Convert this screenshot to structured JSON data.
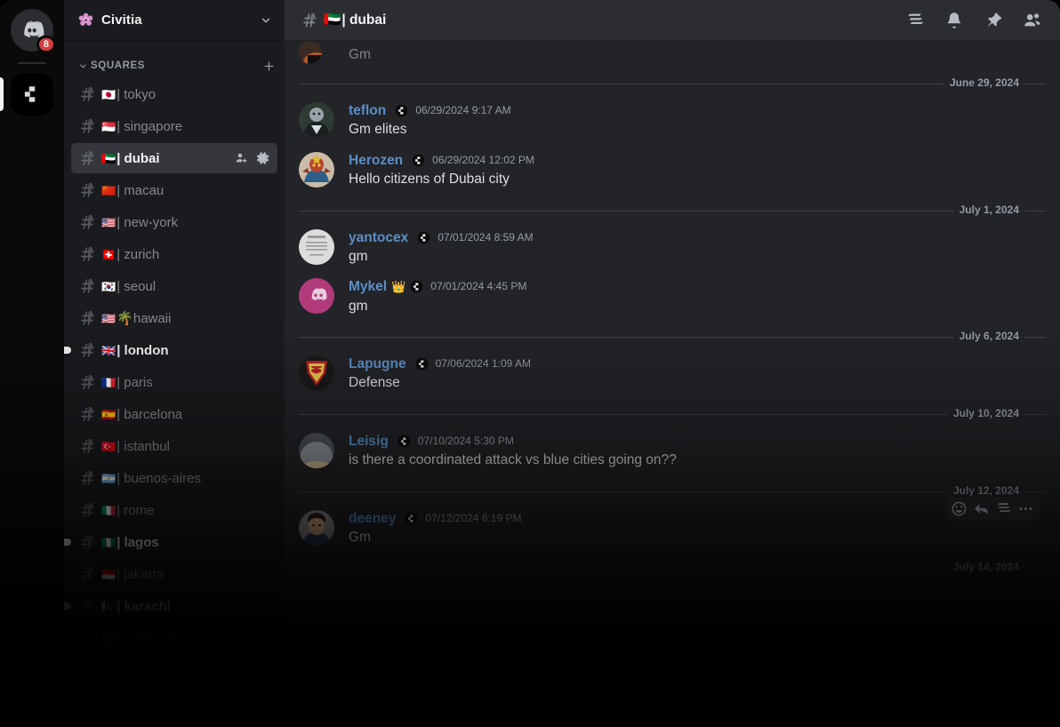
{
  "colors": {
    "accent_username": "#5b8fc7",
    "badge_red": "#d83c3e",
    "sidebar_bg": "#1a1b1e",
    "chat_bg": "#232428",
    "header_bg": "#2b2d31",
    "selected_channel_bg": "#35373c",
    "text_primary": "#f2f3f5",
    "text_muted": "#949ba4"
  },
  "rail": {
    "home_icon": "discord-home-icon",
    "home_badge_count": "8",
    "active_server_icon": "civitia-server-icon"
  },
  "sidebar": {
    "server_name": "Civitia",
    "server_emoji": "pink-flower-icon",
    "dropdown_icon": "chevron-down-icon",
    "category": {
      "label": "SQUARES",
      "collapse_icon": "chevron-down-icon",
      "add_icon": "plus-icon"
    },
    "channels": [
      {
        "flag": "🇯🇵",
        "name": "| tokyo",
        "selected": false,
        "unread": false
      },
      {
        "flag": "🇸🇬",
        "name": "| singapore",
        "selected": false,
        "unread": false
      },
      {
        "flag": "🇦🇪",
        "name": "| dubai",
        "selected": true,
        "unread": false
      },
      {
        "flag": "🇨🇳",
        "name": "| macau",
        "selected": false,
        "unread": false
      },
      {
        "flag": "🇺🇸",
        "name": "| new-york",
        "selected": false,
        "unread": false
      },
      {
        "flag": "🇨🇭",
        "name": "| zurich",
        "selected": false,
        "unread": false
      },
      {
        "flag": "🇰🇷",
        "name": "| seoul",
        "selected": false,
        "unread": false
      },
      {
        "flag": "🇺🇸",
        "name": "🌴hawaii",
        "selected": false,
        "unread": false
      },
      {
        "flag": "🇬🇧",
        "name": "| london",
        "selected": false,
        "unread": true
      },
      {
        "flag": "🇫🇷",
        "name": "| paris",
        "selected": false,
        "unread": false
      },
      {
        "flag": "🇪🇸",
        "name": "| barcelona",
        "selected": false,
        "unread": false
      },
      {
        "flag": "🇹🇷",
        "name": "| istanbul",
        "selected": false,
        "unread": false
      },
      {
        "flag": "🇦🇷",
        "name": "| buenos-aires",
        "selected": false,
        "unread": false
      },
      {
        "flag": "🇮🇹",
        "name": "| rome",
        "selected": false,
        "unread": false
      },
      {
        "flag": "🇳🇬",
        "name": "| lagos",
        "selected": false,
        "unread": true
      },
      {
        "flag": "🇮🇩",
        "name": "| jakarta",
        "selected": false,
        "unread": false
      },
      {
        "flag": "🇵🇰",
        "name": "| karachi",
        "selected": false,
        "unread": true
      },
      {
        "flag": "🇰🇵",
        "name": "| pyongyang",
        "selected": false,
        "unread": false
      }
    ],
    "selected_channel_actions": {
      "add_member_icon": "add-member-icon",
      "settings_icon": "gear-icon"
    }
  },
  "chat_header": {
    "channel_icon": "locked-hash-icon",
    "flag": "🇦🇪",
    "title": "| dubai",
    "icons": [
      "threads-icon",
      "notification-bell-icon",
      "pinned-messages-icon",
      "member-list-icon"
    ]
  },
  "messages": {
    "scrolled_partial": {
      "text": "Gm"
    },
    "groups": [
      {
        "date": "June 29, 2024",
        "items": [
          {
            "avatar": "teflon-avatar",
            "username": "teflon",
            "name_emoji": "",
            "badge": "civitia-badge-icon",
            "timestamp": "06/29/2024 9:17 AM",
            "text": "Gm elites"
          },
          {
            "avatar": "herozen-avatar",
            "username": "Herozen",
            "name_emoji": "",
            "badge": "civitia-badge-icon",
            "timestamp": "06/29/2024 12:02 PM",
            "text": "Hello citizens of Dubai city"
          }
        ]
      },
      {
        "date": "July 1, 2024",
        "items": [
          {
            "avatar": "yantocex-avatar",
            "username": "yantocex",
            "name_emoji": "",
            "badge": "civitia-badge-icon",
            "timestamp": "07/01/2024 8:59 AM",
            "text": "gm"
          },
          {
            "avatar": "mykel-avatar",
            "username": "Mykel",
            "name_emoji": "👑",
            "badge": "civitia-badge-icon",
            "timestamp": "07/01/2024 4:45 PM",
            "text": "gm"
          }
        ]
      },
      {
        "date": "July 6, 2024",
        "items": [
          {
            "avatar": "lapugne-avatar",
            "username": "Lapugne",
            "name_emoji": "",
            "badge": "civitia-badge-icon",
            "timestamp": "07/06/2024 1:09 AM",
            "text": "Defense"
          }
        ]
      },
      {
        "date": "July 10, 2024",
        "items": [
          {
            "avatar": "leisig-avatar",
            "username": "Leisig",
            "name_emoji": "",
            "badge": "civitia-badge-icon",
            "timestamp": "07/10/2024 5:30 PM",
            "text": "is there a coordinated attack vs blue cities going on??"
          }
        ]
      },
      {
        "date": "July 12, 2024",
        "items": [
          {
            "avatar": "deeney-avatar",
            "username": "deeney",
            "name_emoji": "",
            "badge": "civitia-badge-icon",
            "timestamp": "07/12/2024 6:19 PM",
            "text": "Gm",
            "hovered": true
          }
        ]
      },
      {
        "date": "July 14, 2024",
        "items": []
      }
    ],
    "hover_toolbar": [
      "add-reaction-icon",
      "reply-icon",
      "create-thread-icon",
      "more-options-icon"
    ]
  }
}
